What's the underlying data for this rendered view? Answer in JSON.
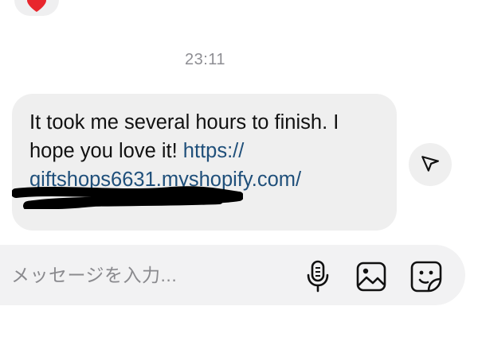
{
  "reaction": {
    "icon": "heart-icon",
    "color": "#e8262d"
  },
  "timestamp": "23:11",
  "message": {
    "text_part1": "It took me several hours to finish. I hope you love it! ",
    "link_part1": "https://",
    "link_part2": "giftshops6631.myshopify.com/"
  },
  "share_button": {
    "icon": "send-icon"
  },
  "composer": {
    "placeholder": "メッセージを入力...",
    "icons": [
      "microphone-icon",
      "image-icon",
      "sticker-icon"
    ]
  },
  "colors": {
    "bubble": "#efefef",
    "link": "#1f4f7a",
    "timestamp": "#8e8e93"
  }
}
